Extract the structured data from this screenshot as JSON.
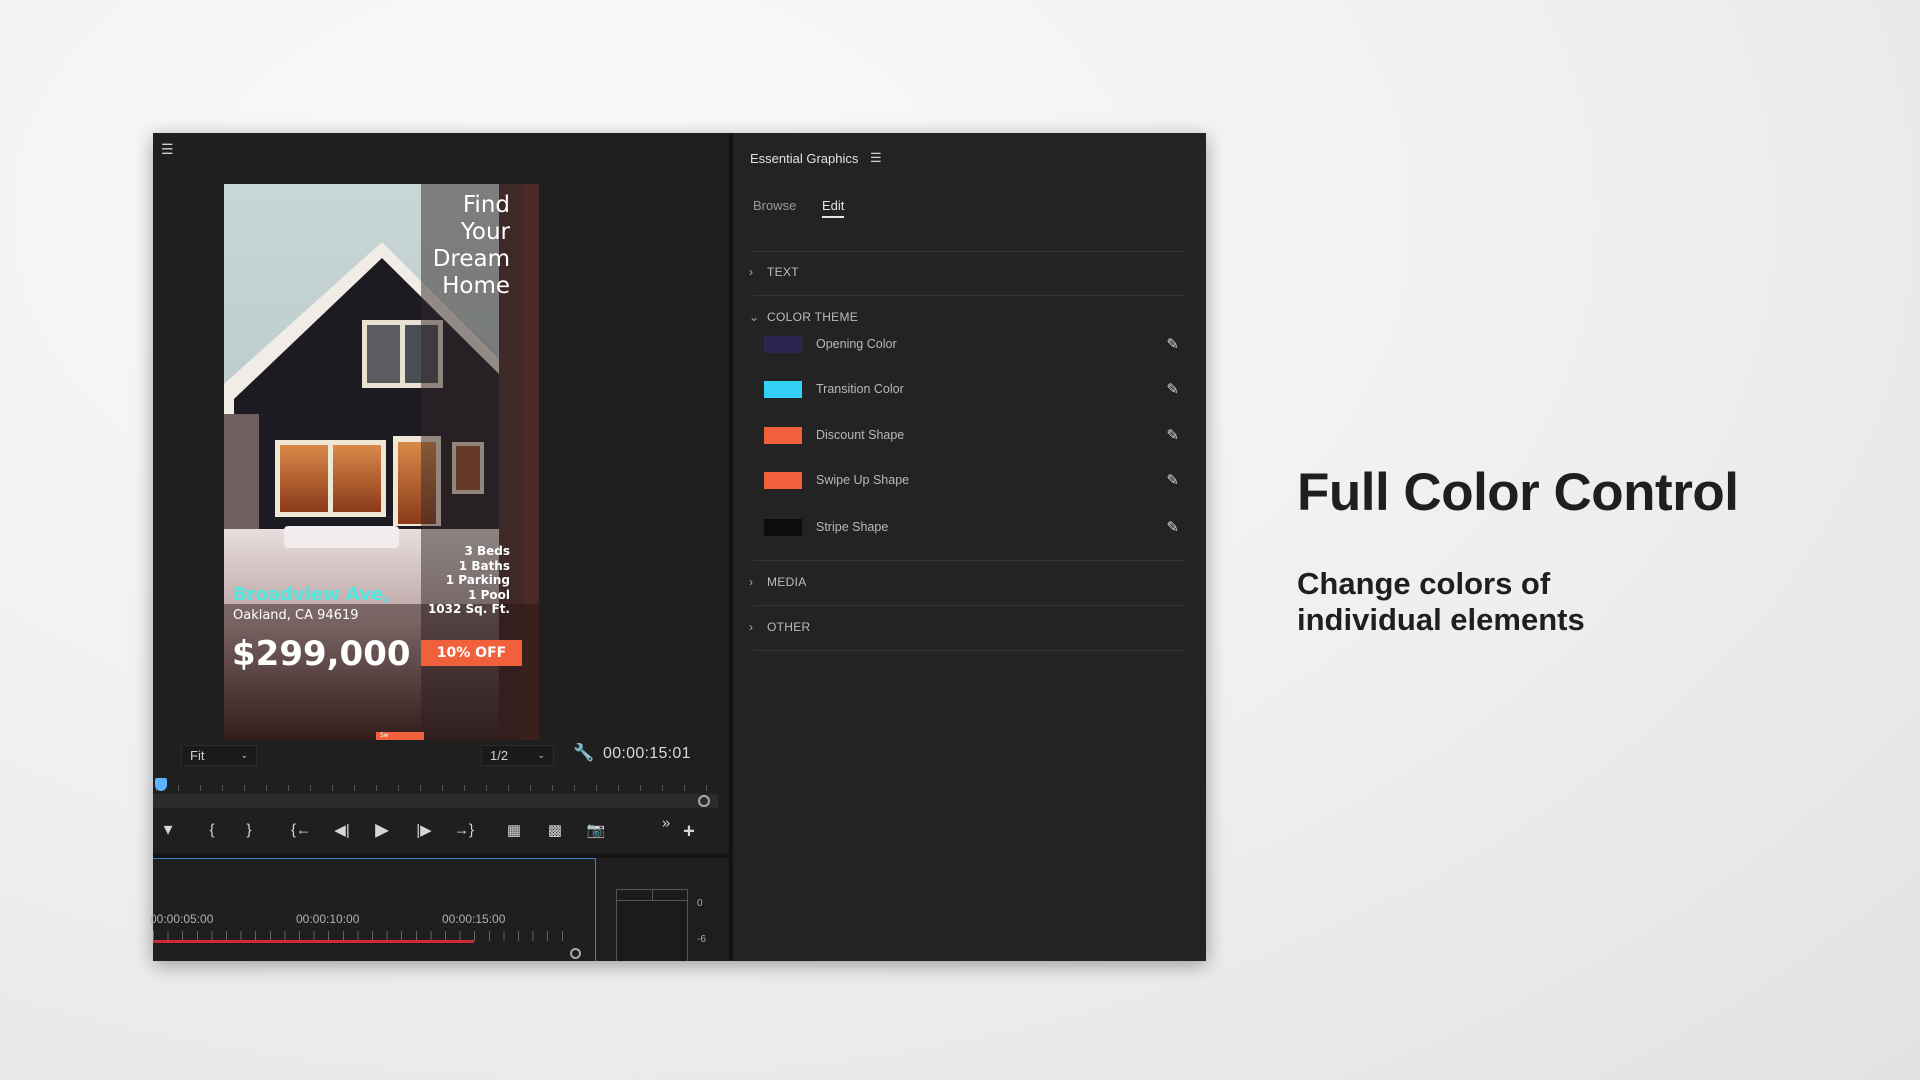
{
  "monitor": {
    "menu_icon": "hamburger-icon",
    "video": {
      "headline": [
        "Find",
        "Your",
        "Dream",
        "Home"
      ],
      "stats": [
        "3 Beds",
        "1 Baths",
        "1 Parking",
        "1 Pool",
        "1032 Sq. Ft."
      ],
      "street": "Broadview Ave,",
      "city": "Oakland, CA 94619",
      "price": "$299,000",
      "discount": "10% OFF",
      "swipe_tab": "Sw"
    },
    "zoom_select": "Fit",
    "resolution_select": "1/2",
    "timecode": "00:00:15:01",
    "controls": [
      "add-marker",
      "mark-in",
      "mark-out",
      "go-to-in",
      "step-back",
      "play",
      "step-forward",
      "go-to-out",
      "insert",
      "overwrite",
      "export-frame",
      "more",
      "add-button"
    ]
  },
  "timeline": {
    "timecodes": [
      "00:00:05:00",
      "00:00:10:00",
      "00:00:15:00"
    ],
    "meter_labels": [
      "0",
      "-6"
    ]
  },
  "essential_graphics": {
    "title": "Essential Graphics",
    "tabs": [
      {
        "label": "Browse",
        "active": false
      },
      {
        "label": "Edit",
        "active": true
      }
    ],
    "sections": {
      "text": "TEXT",
      "color_theme": "COLOR THEME",
      "media": "MEDIA",
      "other": "OTHER"
    },
    "colors": [
      {
        "label": "Opening Color",
        "color": "#2e2450"
      },
      {
        "label": "Transition Color",
        "color": "#33d2f5"
      },
      {
        "label": "Discount Shape",
        "color": "#f0603a"
      },
      {
        "label": "Swipe Up Shape",
        "color": "#f0603a"
      },
      {
        "label": "Stripe Shape",
        "color": "#0c0c0c"
      }
    ]
  },
  "promo": {
    "title": "Full Color Control",
    "subtitle_lines": [
      "Change colors of",
      "individual elements"
    ]
  }
}
